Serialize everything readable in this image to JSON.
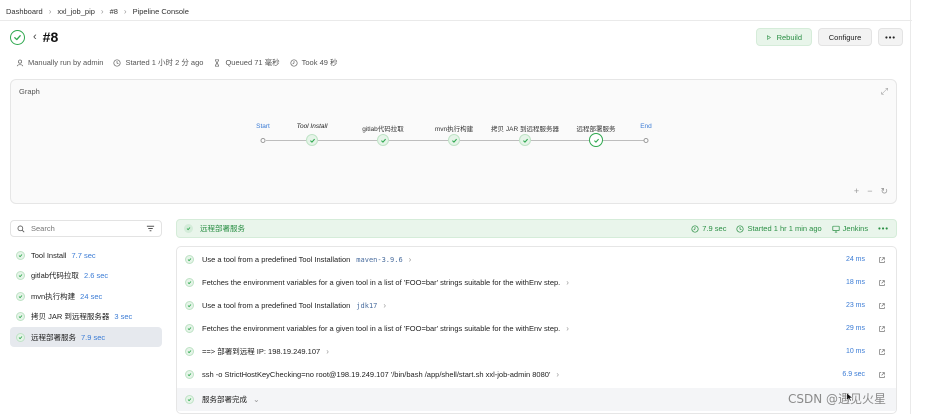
{
  "breadcrumb": [
    "Dashboard",
    "xxl_job_pip",
    "#8",
    "Pipeline Console"
  ],
  "title": "#8",
  "actions": {
    "rebuild": "Rebuild",
    "configure": "Configure",
    "more": "•••"
  },
  "meta": {
    "trigger": "Manually run by admin",
    "started": "Started 1 小时 2 分 ago",
    "queued": "Queued 71 毫秒",
    "took": "Took 49 秒"
  },
  "graph": {
    "title": "Graph",
    "stages": [
      "Start",
      "Tool Install",
      "gitlab代码拉取",
      "mvn执行构建",
      "拷贝 JAR 到远程服务器",
      "远程部署服务",
      "End"
    ]
  },
  "search": {
    "placeholder": "Search"
  },
  "stage_list": [
    {
      "name": "Tool Install",
      "duration": "7.7 sec"
    },
    {
      "name": "gitlab代码拉取",
      "duration": "2.6 sec"
    },
    {
      "name": "mvn执行构建",
      "duration": "24 sec"
    },
    {
      "name": "拷贝 JAR 到远程服务器",
      "duration": "3 sec"
    },
    {
      "name": "远程部署服务",
      "duration": "7.9 sec"
    }
  ],
  "step_header": {
    "name": "远程部署服务",
    "duration": "7.9 sec",
    "started": "Started 1 hr 1 min ago",
    "agent": "Jenkins",
    "more": "•••"
  },
  "steps": [
    {
      "text": "Use a tool from a predefined Tool Installation",
      "code": "maven-3.9.6",
      "time": "24 ms"
    },
    {
      "text": "Fetches the environment variables for a given tool in a list of 'FOO=bar' strings suitable for the withEnv step.",
      "code": "",
      "time": "18 ms"
    },
    {
      "text": "Use a tool from a predefined Tool Installation",
      "code": "jdk17",
      "time": "23 ms"
    },
    {
      "text": "Fetches the environment variables for a given tool in a list of 'FOO=bar' strings suitable for the withEnv step.",
      "code": "",
      "time": "29 ms"
    },
    {
      "text": "==> 部署到远程 IP: 198.19.249.107",
      "code": "",
      "time": "10 ms"
    },
    {
      "text": "ssh -o StrictHostKeyChecking=no root@198.19.249.107 '/bin/bash /app/shell/start.sh xxl-job-admin 8080'",
      "code": "",
      "time": "6.9 sec"
    },
    {
      "text": "服务部署完成",
      "code": "",
      "time": ""
    }
  ],
  "watermark": "CSDN @遇见火星",
  "colors": {
    "success": "#2fa84f",
    "link": "#3a7bd5",
    "header_bg": "#e9f5eb"
  }
}
